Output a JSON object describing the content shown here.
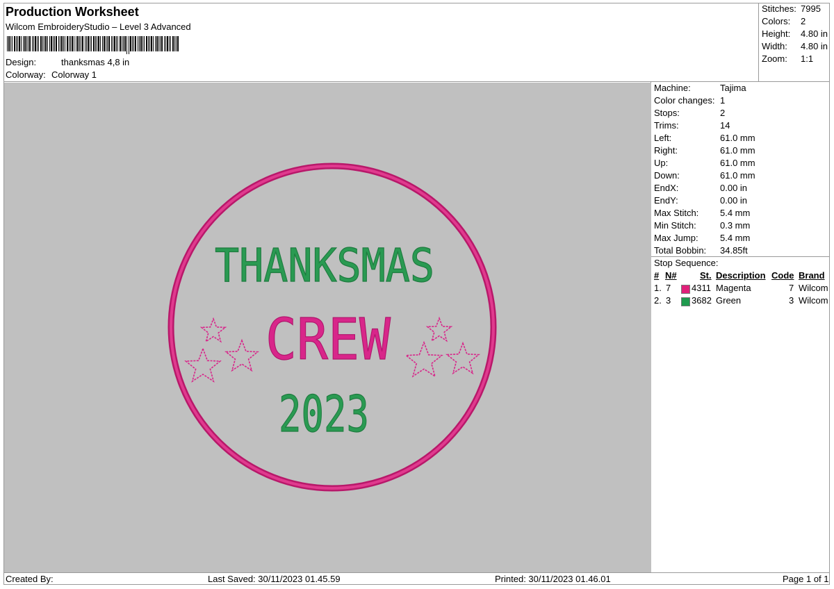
{
  "header": {
    "title": "Production Worksheet",
    "subtitle": "Wilcom EmbroideryStudio – Level 3 Advanced",
    "design_label": "Design:",
    "design_value": "thanksmas 4,8 in",
    "colorway_label": "Colorway:",
    "colorway_value": "Colorway 1"
  },
  "summary": [
    {
      "label": "Stitches:",
      "value": "7995"
    },
    {
      "label": "Colors:",
      "value": "2"
    },
    {
      "label": "Height:",
      "value": "4.80 in"
    },
    {
      "label": "Width:",
      "value": "4.80 in"
    },
    {
      "label": "Zoom:",
      "value": "1:1"
    }
  ],
  "machine_info": [
    {
      "label": "Machine:",
      "value": "Tajima"
    },
    {
      "label": "Color changes:",
      "value": "1"
    },
    {
      "label": "Stops:",
      "value": "2"
    },
    {
      "label": "Trims:",
      "value": "14"
    },
    {
      "label": "Left:",
      "value": "61.0 mm"
    },
    {
      "label": "Right:",
      "value": "61.0 mm"
    },
    {
      "label": "Up:",
      "value": "61.0 mm"
    },
    {
      "label": "Down:",
      "value": "61.0 mm"
    },
    {
      "label": "EndX:",
      "value": "0.00 in"
    },
    {
      "label": "EndY:",
      "value": "0.00 in"
    },
    {
      "label": "Max Stitch:",
      "value": "5.4 mm"
    },
    {
      "label": "Min Stitch:",
      "value": "0.3 mm"
    },
    {
      "label": "Max Jump:",
      "value": "5.4 mm"
    },
    {
      "label": "Total Bobbin:",
      "value": "34.85ft"
    }
  ],
  "stop_sequence": {
    "title": "Stop Sequence:",
    "headers": {
      "num": "#",
      "n": "N#",
      "st": "St.",
      "description": "Description",
      "code": "Code",
      "brand": "Brand"
    },
    "rows": [
      {
        "num": "1.",
        "n": "7",
        "color": "#e0207a",
        "st": "4311",
        "description": "Magenta",
        "code": "7",
        "brand": "Wilcom"
      },
      {
        "num": "2.",
        "n": "3",
        "color": "#1f9a4e",
        "st": "3682",
        "description": "Green",
        "code": "3",
        "brand": "Wilcom"
      }
    ]
  },
  "design": {
    "line1": "THANKSMAS",
    "line2": "CREW",
    "line3": "2023",
    "ring_color": "#d01f7a",
    "text_green": "#2a9a52",
    "text_magenta": "#d8268a",
    "background": "#c0c0c0"
  },
  "footer": {
    "created_by": "Created By:",
    "last_saved": "Last Saved: 30/11/2023 01.45.59",
    "printed": "Printed: 30/11/2023 01.46.01",
    "page": "Page 1 of 1"
  }
}
